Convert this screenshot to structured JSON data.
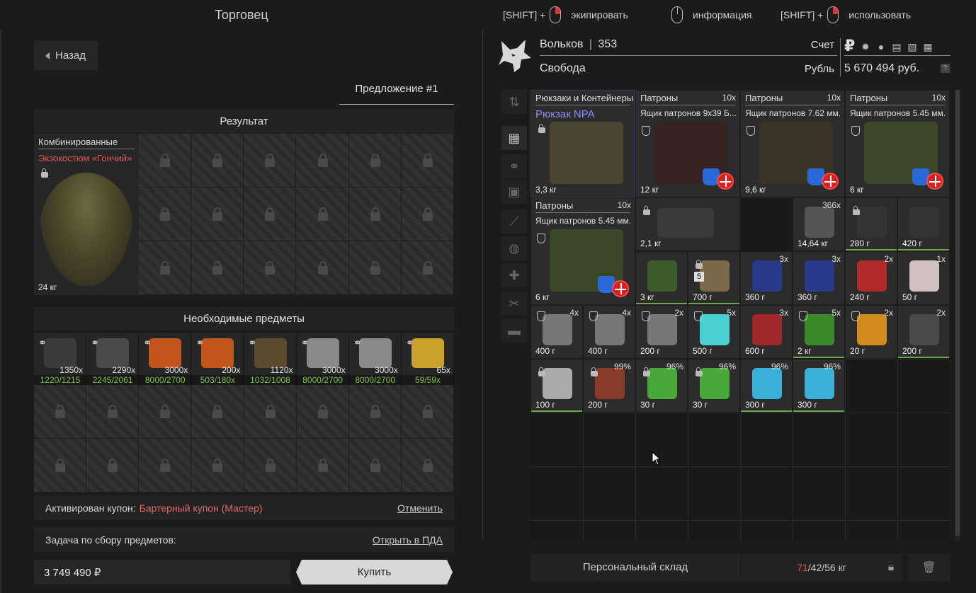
{
  "header": {
    "title": "Торговец",
    "hints": [
      {
        "prefix": "[SHIFT] +",
        "label": "экипировать"
      },
      {
        "prefix": "",
        "label": "информация"
      },
      {
        "prefix": "[SHIFT] +",
        "label": "использовать"
      }
    ]
  },
  "left": {
    "back_label": "Назад",
    "offer_tab": "Предложение #1",
    "result_heading": "Результат",
    "result_item": {
      "category": "Комбинированные",
      "name": "Экзокостюм «Гончий»",
      "weight": "24 кг"
    },
    "required_heading": "Необходимые предметы",
    "required_items": [
      {
        "count": "1350x",
        "progress": "1220/1215"
      },
      {
        "count": "2290x",
        "progress": "2245/2061"
      },
      {
        "count": "3000x",
        "progress": "8000/2700"
      },
      {
        "count": "200x",
        "progress": "503/180x"
      },
      {
        "count": "1120x",
        "progress": "1032/1008"
      },
      {
        "count": "3000x",
        "progress": "8000/2700"
      },
      {
        "count": "3000x",
        "progress": "8000/2700"
      },
      {
        "count": "65x",
        "progress": "59/59x"
      }
    ],
    "coupon": {
      "label": "Активирован купон:",
      "value": "Бартерный купон (Мастер)",
      "action": "Отменить"
    },
    "task": {
      "label": "Задача по сбору предметов:",
      "action": "Открыть в ПДА"
    },
    "price": "3 749 490 ₽",
    "buy_label": "Купить"
  },
  "player": {
    "name": "Вольков",
    "level": "353",
    "faction": "Свобода",
    "account_label": "Счет",
    "currency_label": "Рубль",
    "currency_symbol": "₽",
    "balance": "5 670 494 руб.",
    "help": "?"
  },
  "inventory": {
    "items": [
      {
        "category": "Рюкзаки и Контейнеры",
        "name": "Рюкзак NPA",
        "weight": "3,3 кг"
      },
      {
        "category": "Патроны",
        "qty": "10x",
        "desc": "Ящик патронов 9x39 Б...",
        "weight": "12 кг"
      },
      {
        "category": "Патроны",
        "qty": "10x",
        "desc": "Ящик патронов 7.62 мм...",
        "weight": "9,6 кг"
      },
      {
        "category": "Патроны",
        "qty": "10x",
        "desc": "Ящик патронов 5.45 мм...",
        "weight": "6 кг"
      },
      {
        "category": "Патроны",
        "qty": "10x",
        "desc": "Ящик патронов 5.45 мм...",
        "weight": "6 кг"
      },
      {
        "weight": "2,1 кг"
      },
      {
        "qty": "366x",
        "weight": "14,64 кг"
      },
      {
        "weight": "280 г"
      },
      {
        "weight": "420 г"
      },
      {
        "weight": "3 кг"
      },
      {
        "weight": "700 г",
        "badge": "5"
      },
      {
        "qty": "3x",
        "weight": "360 г"
      },
      {
        "qty": "3x",
        "weight": "360 г"
      },
      {
        "qty": "2x",
        "weight": "240 г"
      },
      {
        "qty": "1x",
        "weight": "50 г"
      },
      {
        "qty": "4x",
        "weight": "400 г"
      },
      {
        "qty": "4x",
        "weight": "400 г"
      },
      {
        "qty": "2x",
        "weight": "200 г"
      },
      {
        "qty": "5x",
        "weight": "500 г"
      },
      {
        "qty": "3x",
        "weight": "600 г"
      },
      {
        "qty": "5x",
        "weight": "2 кг"
      },
      {
        "qty": "2x",
        "weight": "20 г"
      },
      {
        "qty": "2x",
        "weight": "200 г"
      },
      {
        "weight": "100 г"
      },
      {
        "pct": "99%",
        "weight": "200 г"
      },
      {
        "pct": "96%",
        "weight": "30 г"
      },
      {
        "pct": "96%",
        "weight": "30 г"
      },
      {
        "pct": "96%",
        "weight": "300 г"
      },
      {
        "pct": "96%",
        "weight": "300 г"
      }
    ],
    "storage_label": "Персональный склад",
    "weight_current": "71",
    "weight_rest": "/42/56 кг"
  }
}
